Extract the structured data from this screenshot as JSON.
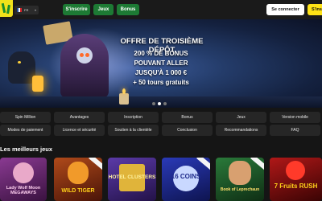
{
  "header": {
    "language": {
      "code": "FR",
      "flag_colors": [
        "#1d4ea0",
        "#ffffff",
        "#d8232a"
      ]
    },
    "nav": [
      {
        "label": "S'inscrire"
      },
      {
        "label": "Jeux"
      },
      {
        "label": "Bonus"
      }
    ],
    "connect_label": "Se connecter",
    "signup_label": "S'inscr"
  },
  "hero": {
    "title": "OFFRE DE TROISIÈME DÉPÔT",
    "lines": [
      "200 % DE BONUS",
      "POUVANT ALLER",
      "JUSQU'À 1 000 €",
      "+ 50 tours gratuits"
    ],
    "slides": 3,
    "active_slide": 1
  },
  "links": [
    "Spin Million",
    "Avantages",
    "Inscription",
    "Bonus",
    "Jeux",
    "Version mobile",
    "Modes de paiement",
    "Licence et sécurité",
    "Soutien à la clientèle",
    "Conclusion",
    "Recommandations",
    "FAQ"
  ],
  "games_section": {
    "title": "Les meilleurs jeux",
    "games": [
      {
        "name": "Lady Wolf Moon MEGAWAYS",
        "bg": "#6a2a6f",
        "accent": "#ff5fb0"
      },
      {
        "name": "WILD TIGER",
        "bg": "#7a2a1a",
        "accent": "#ffb21a"
      },
      {
        "name": "HOTEL CLUSTERS",
        "bg": "#3a2a78",
        "accent": "#ffd24a"
      },
      {
        "name": "16 COINS",
        "bg": "#1e2a8a",
        "accent": "#7fc6ff"
      },
      {
        "name": "Book of Leprechaun",
        "bg": "#1c5a2a",
        "accent": "#ff3a3a"
      },
      {
        "name": "7 Fruits RUSH",
        "bg": "#8a1010",
        "accent": "#ffd21a"
      }
    ]
  }
}
